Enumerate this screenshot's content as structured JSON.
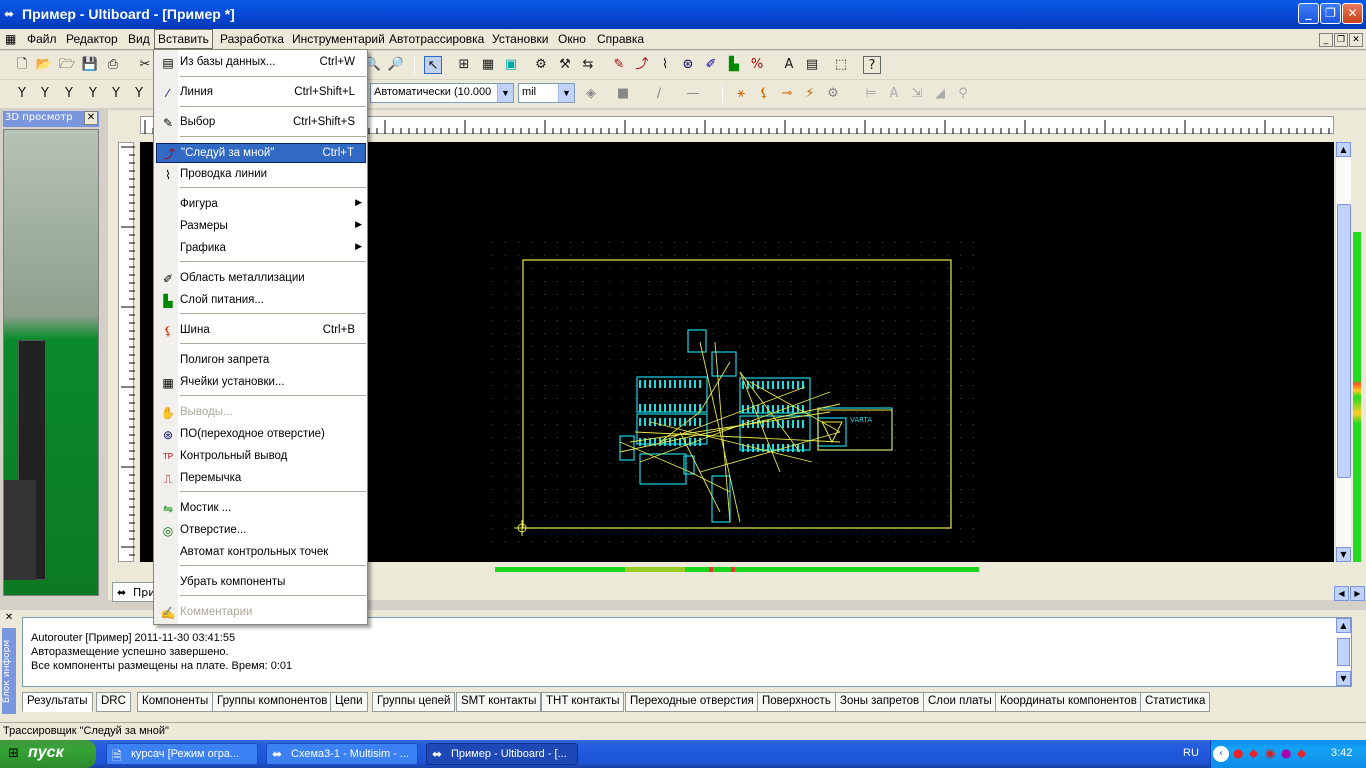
{
  "window": {
    "title": "Пример - Ultiboard - [Пример *]"
  },
  "menubar": {
    "items": [
      "Файл",
      "Редактор",
      "Вид",
      "Вставить",
      "Разработка",
      "Инструментарий",
      "Автотрассировка",
      "Установки",
      "Окно",
      "Справка"
    ],
    "active": "Вставить"
  },
  "toolbar": {
    "grid_combo": "Автоматически (10.000",
    "units_combo": "mil"
  },
  "insert_menu": {
    "items": [
      {
        "label": "Из базы данных...",
        "shortcut": "Ctrl+W",
        "icon": "database-icon"
      },
      {
        "label": "Линия",
        "shortcut": "Ctrl+Shift+L",
        "icon": "line-icon"
      },
      {
        "label": "Выбор",
        "shortcut": "Ctrl+Shift+S",
        "icon": "select-icon"
      },
      {
        "label": "\"Следуй за мной\"",
        "shortcut": "Ctrl+T",
        "icon": "follow-me-icon",
        "highlighted": true
      },
      {
        "label": "Проводка линии",
        "shortcut": "",
        "icon": "wire-icon"
      },
      {
        "label": "Фигура",
        "shortcut": "",
        "submenu": true
      },
      {
        "label": "Размеры",
        "shortcut": "",
        "submenu": true
      },
      {
        "label": "Графика",
        "shortcut": "",
        "submenu": true
      },
      {
        "label": "Область металлизации",
        "shortcut": "",
        "icon": "copper-area-icon"
      },
      {
        "label": "Слой питания...",
        "shortcut": "",
        "icon": "power-plane-icon"
      },
      {
        "label": "Шина",
        "shortcut": "Ctrl+B",
        "icon": "bus-icon"
      },
      {
        "label": "Полигон запрета",
        "shortcut": ""
      },
      {
        "label": "Ячейки установки...",
        "shortcut": "",
        "icon": "placement-cells-icon"
      },
      {
        "label": "Выводы...",
        "shortcut": "",
        "icon": "pins-icon",
        "disabled": true
      },
      {
        "label": "ПО(переходное отверстие)",
        "shortcut": "",
        "icon": "via-icon"
      },
      {
        "label": "Контрольный вывод",
        "shortcut": "",
        "icon": "test-point-icon"
      },
      {
        "label": "Перемычка",
        "shortcut": "",
        "icon": "jumper-icon"
      },
      {
        "label": "Мостик ...",
        "shortcut": "",
        "icon": "bridge-icon"
      },
      {
        "label": "Отверстие...",
        "shortcut": "",
        "icon": "hole-icon"
      },
      {
        "label": "Автомат контрольных точек",
        "shortcut": ""
      },
      {
        "label": "Убрать компоненты",
        "shortcut": ""
      },
      {
        "label": "Комментарии",
        "shortcut": "",
        "icon": "comment-icon",
        "disabled": true
      }
    ]
  },
  "panel3d": {
    "title": "3D просмотр"
  },
  "board": {
    "label": "VARTA"
  },
  "doc_tab": {
    "label": "При"
  },
  "output": {
    "lines": [
      "Autorouter [Пример]  2011-11-30 03:41:55",
      "Авторазмещение успешно завершено.",
      "Все компоненты размещены на плате.  Время: 0:01"
    ],
    "side_title": "Блок информ"
  },
  "bottom_tabs": [
    "Результаты",
    "DRC",
    "Компоненты",
    "Группы компонентов",
    "Цепи",
    "Группы цепей",
    "SMT контакты",
    "THT контакты",
    "Переходные отверстия",
    "Поверхность",
    "Зоны запретов",
    "Слои платы",
    "Координаты компонентов",
    "Статистика"
  ],
  "status": {
    "text": "Трассировщик \"Следуй за мной\""
  },
  "taskbar": {
    "start": "пуск",
    "tasks": [
      "курсач [Режим огра...",
      "Схема3-1 - Multisim - ...",
      "Пример - Ultiboard - [..."
    ],
    "lang": "RU",
    "clock": "3:42"
  }
}
